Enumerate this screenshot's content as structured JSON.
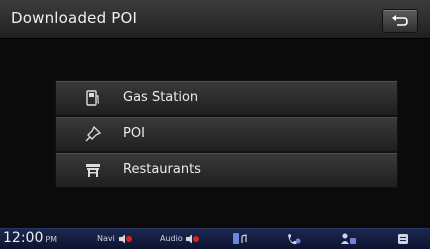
{
  "header": {
    "title": "Downloaded POI"
  },
  "menu": {
    "items": [
      {
        "label": "Gas Station",
        "icon": "gas-pump-icon"
      },
      {
        "label": "POI",
        "icon": "pin-icon"
      },
      {
        "label": "Restaurants",
        "icon": "restaurant-icon"
      }
    ]
  },
  "status": {
    "time": "12:00",
    "ampm": "PM",
    "navi_label": "Navi",
    "audio_label": "Audio"
  },
  "colors": {
    "header_bg": "#2e2e2e",
    "screen_bg": "#0b0b0b",
    "statusbar_bg": "#16204a",
    "mute_red": "#e02020"
  }
}
